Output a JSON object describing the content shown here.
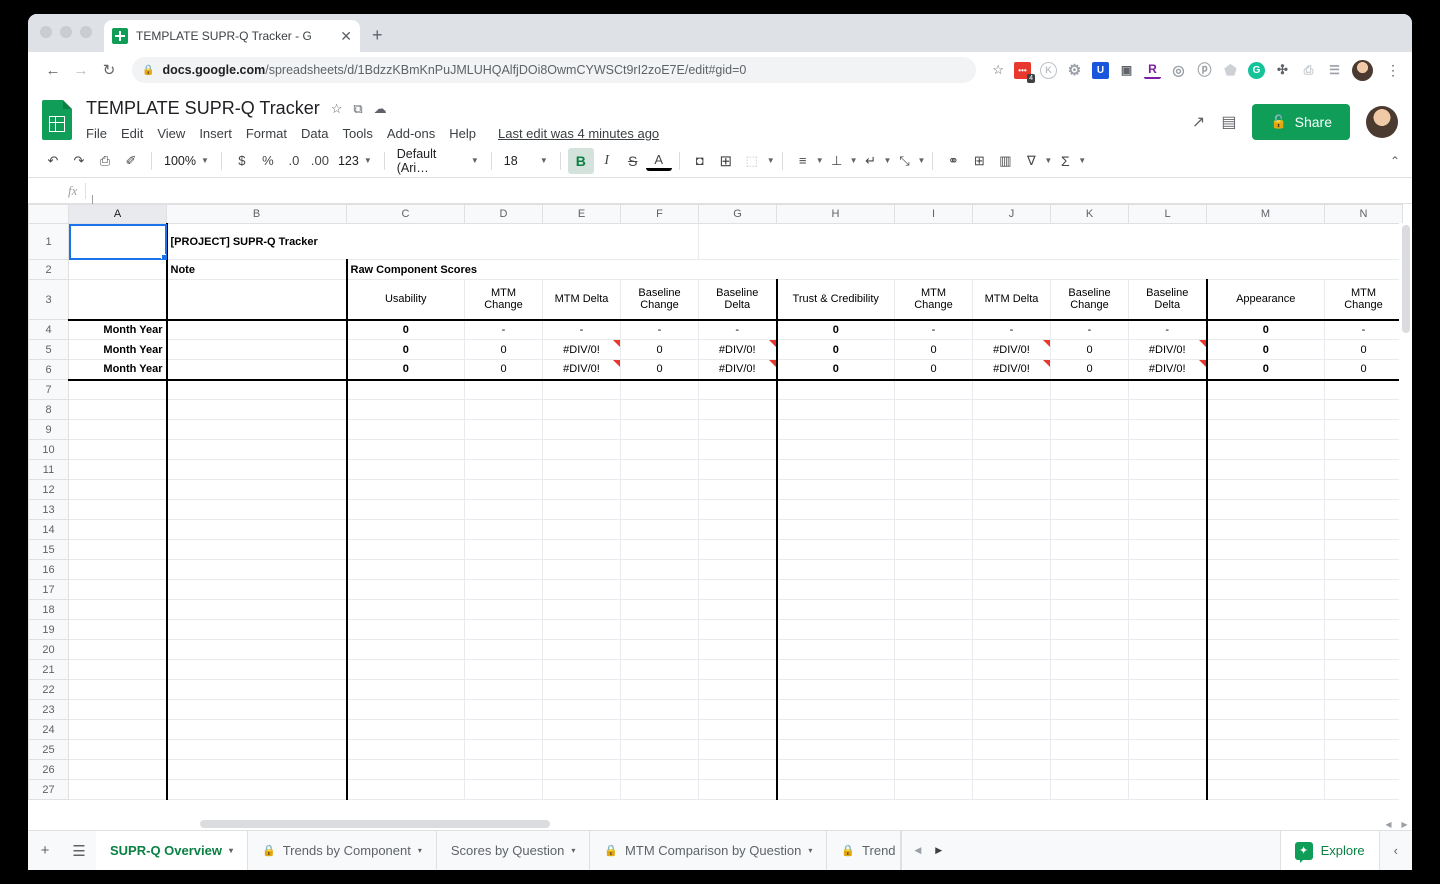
{
  "browser": {
    "tab_title": "TEMPLATE SUPR-Q Tracker - G",
    "close_icon": "close-icon",
    "new_tab_icon": "+",
    "back_icon": "←",
    "forward_icon": "→",
    "reload_icon": "↻",
    "lock_icon": "🔒",
    "url_domain": "docs.google.com",
    "url_path": "/spreadsheets/d/1BdzzKBmKnPuJMLUHQAlfjDOi8OwmCYWSCt9rI2zoE7E/edit#gid=0",
    "star_icon": "☆",
    "menu_icon": "⋮",
    "extensions": [
      {
        "name": "todoist-extension",
        "glyph": "•••",
        "color": "#e8392e",
        "bg": "#e8392e",
        "badge": "4"
      },
      {
        "name": "grammarly-k-extension",
        "glyph": "K",
        "color": "#9aa0a6",
        "bg": "transparent"
      },
      {
        "name": "settings-gear-extension",
        "glyph": "⚙",
        "color": "#9aa0a6",
        "bg": "transparent"
      },
      {
        "name": "ublock-extension",
        "glyph": "U",
        "color": "#fff",
        "bg": "#1a56db"
      },
      {
        "name": "screenshot-camera-extension",
        "glyph": "📷",
        "color": "#5f6368",
        "bg": "transparent"
      },
      {
        "name": "r-reader-extension",
        "glyph": "R",
        "color": "#7b1fa2",
        "bg": "transparent"
      },
      {
        "name": "circle-target-extension",
        "glyph": "◎",
        "color": "#9aa0a6",
        "bg": "transparent"
      },
      {
        "name": "pinterest-extension",
        "glyph": "ⓟ",
        "color": "#9aa0a6",
        "bg": "transparent"
      },
      {
        "name": "bookmark-flag-extension",
        "glyph": "⚑",
        "color": "#bdc1c6",
        "bg": "transparent"
      },
      {
        "name": "grammarly-g-extension",
        "glyph": "G",
        "color": "#fff",
        "bg": "#15c39a"
      },
      {
        "name": "puzzle-extensions-icon",
        "glyph": "🧩",
        "color": "#5f6368",
        "bg": "transparent"
      },
      {
        "name": "cast-icon",
        "glyph": "⬚",
        "color": "#bdc1c6",
        "bg": "transparent"
      },
      {
        "name": "media-list-icon",
        "glyph": "☰",
        "color": "#9aa0a6",
        "bg": "transparent"
      }
    ]
  },
  "sheets_header": {
    "doc_title": "TEMPLATE SUPR-Q Tracker",
    "star_icon": "☆",
    "move_icon": "⧉",
    "cloud_icon": "☁",
    "menus": [
      "File",
      "Edit",
      "View",
      "Insert",
      "Format",
      "Data",
      "Tools",
      "Add-ons",
      "Help"
    ],
    "last_edit": "Last edit was 4 minutes ago",
    "trend_icon": "↗",
    "comment_icon": "▤",
    "share_label": "Share",
    "share_color": "#0f9d58"
  },
  "toolbar": {
    "undo": "↶",
    "redo": "↷",
    "print": "⎙",
    "paint": "✐",
    "zoom": "100%",
    "currency": "$",
    "percent": "%",
    "dec_decrease": ".0",
    "dec_increase": ".00",
    "formats": "123",
    "font": "Default (Ari…",
    "font_size": "18",
    "bold": "B",
    "italic": "I",
    "strike": "S",
    "text_color": "A",
    "fill_color": "◘",
    "borders": "⊞",
    "merge": "⬚",
    "halign": "≡",
    "valign": "⊥",
    "wrap": "↵",
    "rotate": "⤡",
    "link": "⚭",
    "comment_add": "⊞",
    "chart": "Ὄa",
    "filter": "∇",
    "functions": "Σ",
    "collapse": "⌃"
  },
  "formula_bar": {
    "name_box": "",
    "fx_label": "fx",
    "value": ""
  },
  "grid": {
    "columns": [
      "A",
      "B",
      "C",
      "D",
      "E",
      "F",
      "G",
      "H",
      "I",
      "J",
      "K",
      "L",
      "M",
      "N"
    ],
    "selected_cell": "A1",
    "rows_visible": [
      1,
      2,
      3,
      4,
      5,
      6,
      7,
      8,
      9,
      10,
      11,
      12,
      13,
      14,
      15,
      16,
      17,
      18,
      19,
      20,
      21,
      22,
      23,
      24,
      25,
      26,
      27
    ],
    "title_cell": "[PROJECT] SUPR-Q Tracker",
    "note_label": "Note",
    "raw_label": "Raw Component Scores",
    "headers": [
      {
        "label": "Usability",
        "fill": "blue",
        "col": "C"
      },
      {
        "label": "MTM\nChange",
        "fill": "blue",
        "col": "D"
      },
      {
        "label": "MTM Delta",
        "fill": "blue",
        "col": "E"
      },
      {
        "label": "Baseline\nChange",
        "fill": "blue",
        "col": "F"
      },
      {
        "label": "Baseline\nDelta",
        "fill": "blue",
        "col": "G"
      },
      {
        "label": "Trust & Credibility",
        "fill": "pink",
        "col": "H"
      },
      {
        "label": "MTM\nChange",
        "fill": "pink",
        "col": "I"
      },
      {
        "label": "MTM Delta",
        "fill": "pink",
        "col": "J"
      },
      {
        "label": "Baseline\nChange",
        "fill": "pink",
        "col": "K"
      },
      {
        "label": "Baseline\nDelta",
        "fill": "pink",
        "col": "L"
      },
      {
        "label": "Appearance",
        "fill": "lav",
        "col": "M"
      },
      {
        "label": "MTM\nChange",
        "fill": "lav",
        "col": "N"
      }
    ],
    "data_rows": [
      {
        "row": 4,
        "a": "Month Year",
        "b": "",
        "cells": [
          "0",
          "-",
          "-",
          "-",
          "-",
          "0",
          "-",
          "-",
          "-",
          "-",
          "0",
          "-"
        ]
      },
      {
        "row": 5,
        "a": "Month Year",
        "b": "",
        "cells": [
          "0",
          "0",
          "#DIV/0!",
          "0",
          "#DIV/0!",
          "0",
          "0",
          "#DIV/0!",
          "0",
          "#DIV/0!",
          "0",
          "0"
        ]
      },
      {
        "row": 6,
        "a": "Month Year",
        "b": "",
        "cells": [
          "0",
          "0",
          "#DIV/0!",
          "0",
          "#DIV/0!",
          "0",
          "0",
          "#DIV/0!",
          "0",
          "#DIV/0!",
          "0",
          "0"
        ]
      }
    ],
    "colors": {
      "blue": "#c9daf8",
      "pink": "#f4cccc",
      "lavender": "#ead1dc",
      "yellow": "#ffff00",
      "gray": "#f3f3f3",
      "selection": "#1a73e8"
    }
  },
  "sheet_tabs": {
    "add_icon": "+",
    "all_sheets_icon": "☰",
    "tabs": [
      {
        "label": "SUPR-Q Overview",
        "locked": false,
        "active": true
      },
      {
        "label": "Trends by Component",
        "locked": true,
        "active": false
      },
      {
        "label": "Scores by Question",
        "locked": false,
        "active": false
      },
      {
        "label": "MTM Comparison by Question",
        "locked": true,
        "active": false
      },
      {
        "label": "Trend",
        "locked": true,
        "active": false
      }
    ],
    "prev_icon": "◀",
    "next_icon": "▶",
    "explore_label": "Explore",
    "collapse_icon": "‹",
    "dropdown_icon": "▾",
    "lock_icon": "🔒"
  }
}
